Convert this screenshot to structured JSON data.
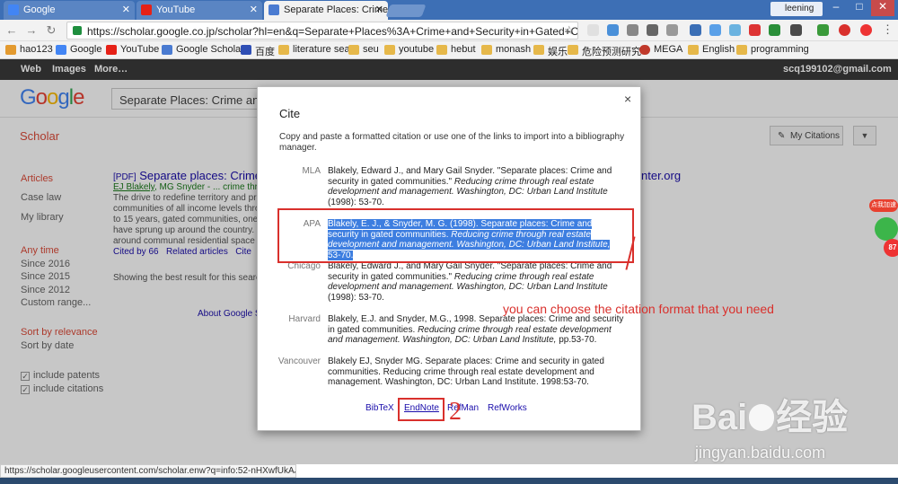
{
  "tabs": [
    {
      "title": "Google",
      "color": "#4285f4"
    },
    {
      "title": "YouTube",
      "color": "#e62117"
    },
    {
      "title": "Separate Places: Crime",
      "color": "#4a7bd1"
    }
  ],
  "profile_name": "leening",
  "url": "https://scholar.google.co.jp/scholar?hl=en&q=Separate+Places%3A+Crime+and+Security+in+Gated+Comm",
  "bookmarks": [
    "hao123",
    "Google",
    "YouTube",
    "Google Scholar",
    "百度",
    "literature sea",
    "seu",
    "youtube",
    "hebut",
    "monash",
    "娱乐",
    "危险预测研究",
    "MEGA",
    "English",
    "programming"
  ],
  "google_bar": {
    "web": "Web",
    "images": "Images",
    "more": "More…",
    "email": "scq199102@gmail.com"
  },
  "search_query": "Separate Places: Crime and Se",
  "logo": "Google",
  "scholar_label": "Scholar",
  "my_citations": "My Citations",
  "sidebar": {
    "articles": "Articles",
    "case_law": "Case law",
    "my_library": "My library",
    "any_time": "Any time",
    "since_2016": "Since 2016",
    "since_2015": "Since 2015",
    "since_2012": "Since 2012",
    "custom_range": "Custom range...",
    "sort_relevance": "Sort by relevance",
    "sort_date": "Sort by date",
    "include_patents": "include patents",
    "include_citations": "include citations"
  },
  "result": {
    "tag": "[PDF]",
    "title": "Separate places: Crime",
    "domain_tail": "nter.org",
    "authors": "EJ Blakely",
    "authors_rest": ", MG Snyder - ... crime thr",
    "snippet": [
      "The drive to redefine territory and prot",
      "communities of all income levels throu",
      "to 15 years, gated communities, one c",
      "have sprung up around the country. M",
      "around communal residential space th"
    ],
    "cited_by": "Cited by 66",
    "related": "Related articles",
    "cite": "Cite",
    "showing": "Showing the best result for this search",
    "about": "About Google S"
  },
  "dialog": {
    "close": "×",
    "title": "Cite",
    "instruction": "Copy and paste a formatted citation or use one of the links to import into a bibliography manager.",
    "formats": [
      {
        "label": "MLA",
        "text_a": "Blakely, Edward J., and Mary Gail Snyder. \"Separate places: Crime and security in gated communities.\" ",
        "text_i": "Reducing crime through real estate development and management. Washington, DC: Urban Land Institute",
        "text_b": " (1998): 53-70."
      },
      {
        "label": "APA",
        "text_a": "Blakely, E. J., & Snyder, M. G. (1998). Separate places: Crime and security in gated communities. ",
        "text_i": "Reducing crime through real estate development and management. Washington, DC: Urban Land Institute,",
        "text_b": " 53-70."
      },
      {
        "label": "Chicago",
        "text_a": "Blakely, Edward J., and Mary Gail Snyder. \"Separate places: Crime and security in gated communities.\" ",
        "text_i": "Reducing crime through real estate development and management. Washington, DC: Urban Land Institute",
        "text_b": " (1998): 53-70."
      },
      {
        "label": "Harvard",
        "text_a": "Blakely, E.J. and Snyder, M.G., 1998. Separate places: Crime and security in gated communities. ",
        "text_i": "Reducing crime through real estate development and management. Washington, DC: Urban Land Institute,",
        "text_b": " pp.53-70."
      },
      {
        "label": "Vancouver",
        "text_a": "Blakely EJ, Snyder MG. Separate places: Crime and security in gated communities. Reducing crime through real estate development and management. Washington, DC: Urban Land Institute. 1998:53-70.",
        "text_i": "",
        "text_b": ""
      }
    ],
    "links": {
      "bibtex": "BibTeX",
      "endnote": "EndNote",
      "refman": "RefMan",
      "refworks": "RefWorks"
    }
  },
  "annotation": {
    "text": "you can choose the citation format that you need",
    "number": "2"
  },
  "widget_text": "点我加速",
  "widget_value": "87",
  "status_url": "https://scholar.googleusercontent.com/scholar.enw?q=info:52-nHXwfUkAJ:...",
  "watermark": {
    "brand": "Bai",
    "brand_cn": "经验",
    "url": "jingyan.baidu.com"
  }
}
